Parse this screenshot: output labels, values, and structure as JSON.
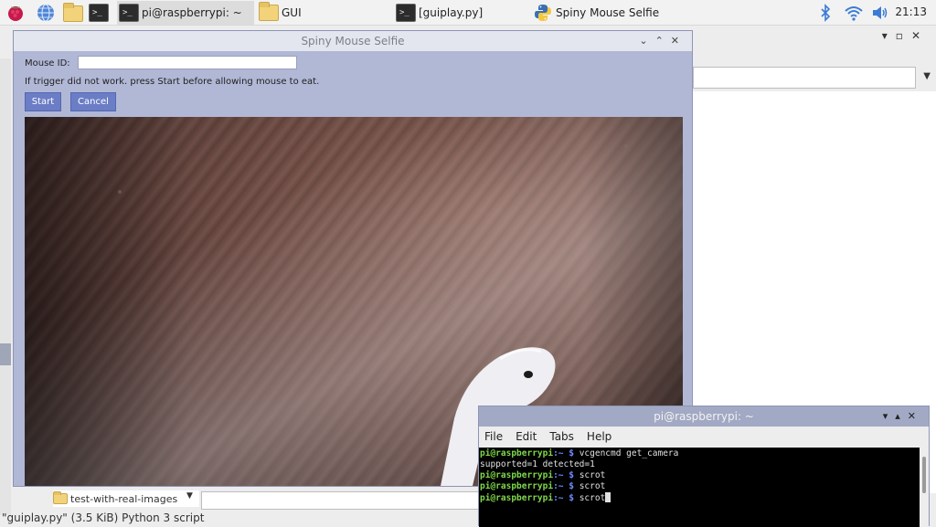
{
  "taskbar": {
    "tasks": [
      {
        "label": "pi@raspberrypi: ~",
        "icon": "terminal-icon",
        "active": true
      },
      {
        "label": "GUI",
        "icon": "folder-icon"
      },
      {
        "label": "[guiplay.py]",
        "icon": "terminal-icon"
      },
      {
        "label": "Spiny Mouse Selfie",
        "icon": "python-icon"
      }
    ],
    "clock": "21:13"
  },
  "background_window": {
    "sidebar_item": "test-with-real-images",
    "statusbar": "\"guiplay.py\" (3.5 KiB) Python 3 script"
  },
  "app": {
    "title": "Spiny Mouse Selfie",
    "mouse_id_label": "Mouse ID:",
    "mouse_id_value": "",
    "instruction": "If trigger did not work. press Start before allowing mouse to eat.",
    "start_label": "Start",
    "cancel_label": "Cancel"
  },
  "terminal": {
    "title": "pi@raspberrypi: ~",
    "menu": [
      "File",
      "Edit",
      "Tabs",
      "Help"
    ],
    "prompt_user": "pi@raspberrypi",
    "prompt_path": ":~ $",
    "lines": [
      {
        "cmd": " vcgencmd get_camera"
      },
      {
        "output": "supported=1 detected=1"
      },
      {
        "cmd": " scrot"
      },
      {
        "cmd": " scrot"
      },
      {
        "cmd": " scrot"
      }
    ]
  },
  "colors": {
    "app_background": "#b1b8d6",
    "button": "#6b7dc6",
    "terminal_titlebar": "#a2a9c4",
    "prompt_user": "#7ed84b",
    "prompt_path": "#6f8cff"
  }
}
